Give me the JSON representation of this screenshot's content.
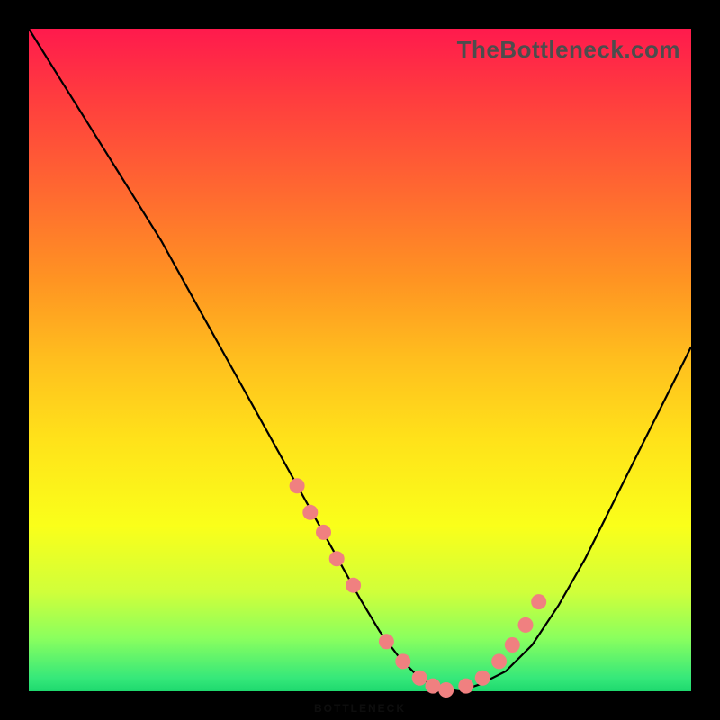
{
  "watermark": "TheBottleneck.com",
  "chart_data": {
    "type": "line",
    "title": "",
    "xlabel": "",
    "ylabel": "",
    "xlim": [
      0,
      100
    ],
    "ylim": [
      0,
      100
    ],
    "series": [
      {
        "name": "bottleneck-curve",
        "x": [
          0,
          5,
          10,
          15,
          20,
          25,
          30,
          35,
          40,
          45,
          50,
          53,
          56,
          59,
          62,
          65,
          68,
          72,
          76,
          80,
          84,
          88,
          92,
          96,
          100
        ],
        "values": [
          100,
          92,
          84,
          76,
          68,
          59,
          50,
          41,
          32,
          23,
          14,
          9,
          5,
          2,
          0.5,
          0,
          1,
          3,
          7,
          13,
          20,
          28,
          36,
          44,
          52
        ]
      }
    ],
    "markers": {
      "name": "suggested-range",
      "x": [
        40.5,
        42.5,
        44.5,
        46.5,
        49.0,
        54.0,
        56.5,
        59.0,
        61.0,
        63.0,
        66.0,
        68.5,
        71.0,
        73.0,
        75.0,
        77.0
      ],
      "values": [
        31.0,
        27.0,
        24.0,
        20.0,
        16.0,
        7.5,
        4.5,
        2.0,
        0.8,
        0.2,
        0.8,
        2.0,
        4.5,
        7.0,
        10.0,
        13.5
      ]
    },
    "marker_color": "#f08080",
    "curve_color": "#000000"
  }
}
